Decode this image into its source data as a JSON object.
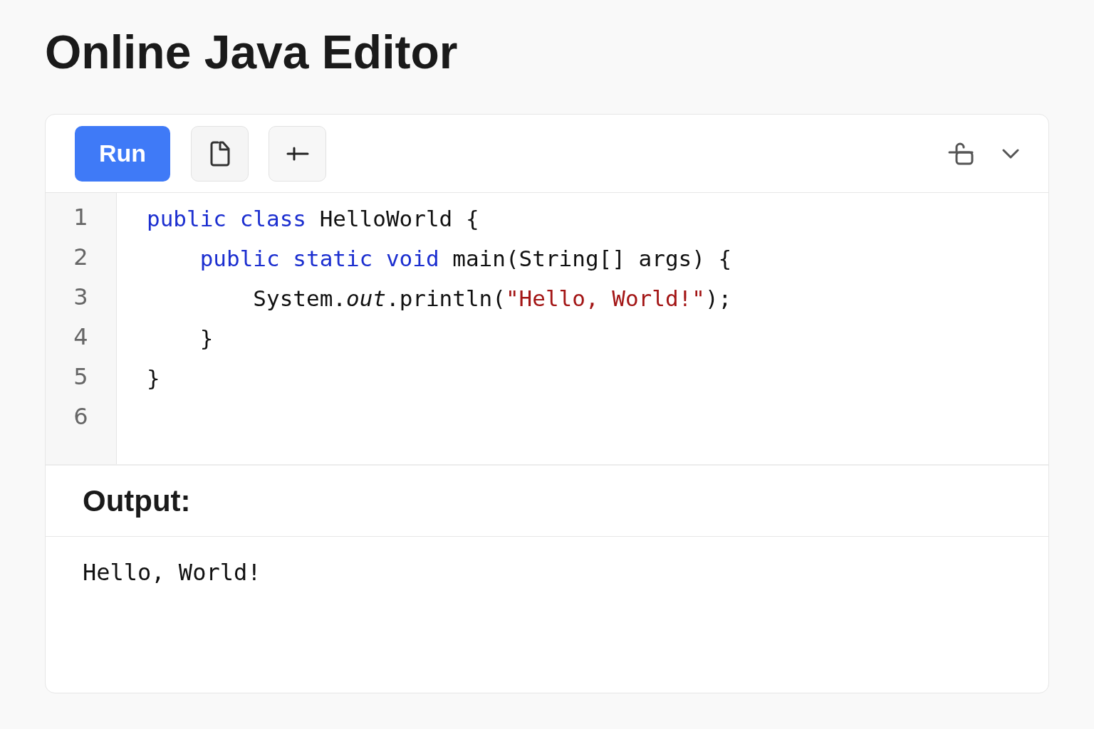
{
  "title": "Online Java Editor",
  "toolbar": {
    "run_label": "Run"
  },
  "code_lines": [
    {
      "number": "1",
      "tokens": [
        {
          "kind": "keyword",
          "text": "public class"
        },
        {
          "kind": "plain",
          "text": " HelloWorld {"
        }
      ]
    },
    {
      "number": "2",
      "tokens": [
        {
          "kind": "keyword",
          "text": "    public static void"
        },
        {
          "kind": "plain",
          "text": " main(String[] args) {"
        }
      ]
    },
    {
      "number": "3",
      "tokens": [
        {
          "kind": "plain",
          "text": "        System."
        },
        {
          "kind": "italic",
          "text": "out"
        },
        {
          "kind": "plain",
          "text": ".println("
        },
        {
          "kind": "string",
          "text": "\"Hello, World!\""
        },
        {
          "kind": "plain",
          "text": ");"
        }
      ]
    },
    {
      "number": "4",
      "tokens": [
        {
          "kind": "plain",
          "text": "    }"
        }
      ]
    },
    {
      "number": "5",
      "tokens": [
        {
          "kind": "plain",
          "text": "}"
        }
      ]
    },
    {
      "number": "6"
    }
  ],
  "output": {
    "heading": "Output:",
    "text": "Hello, World!"
  }
}
